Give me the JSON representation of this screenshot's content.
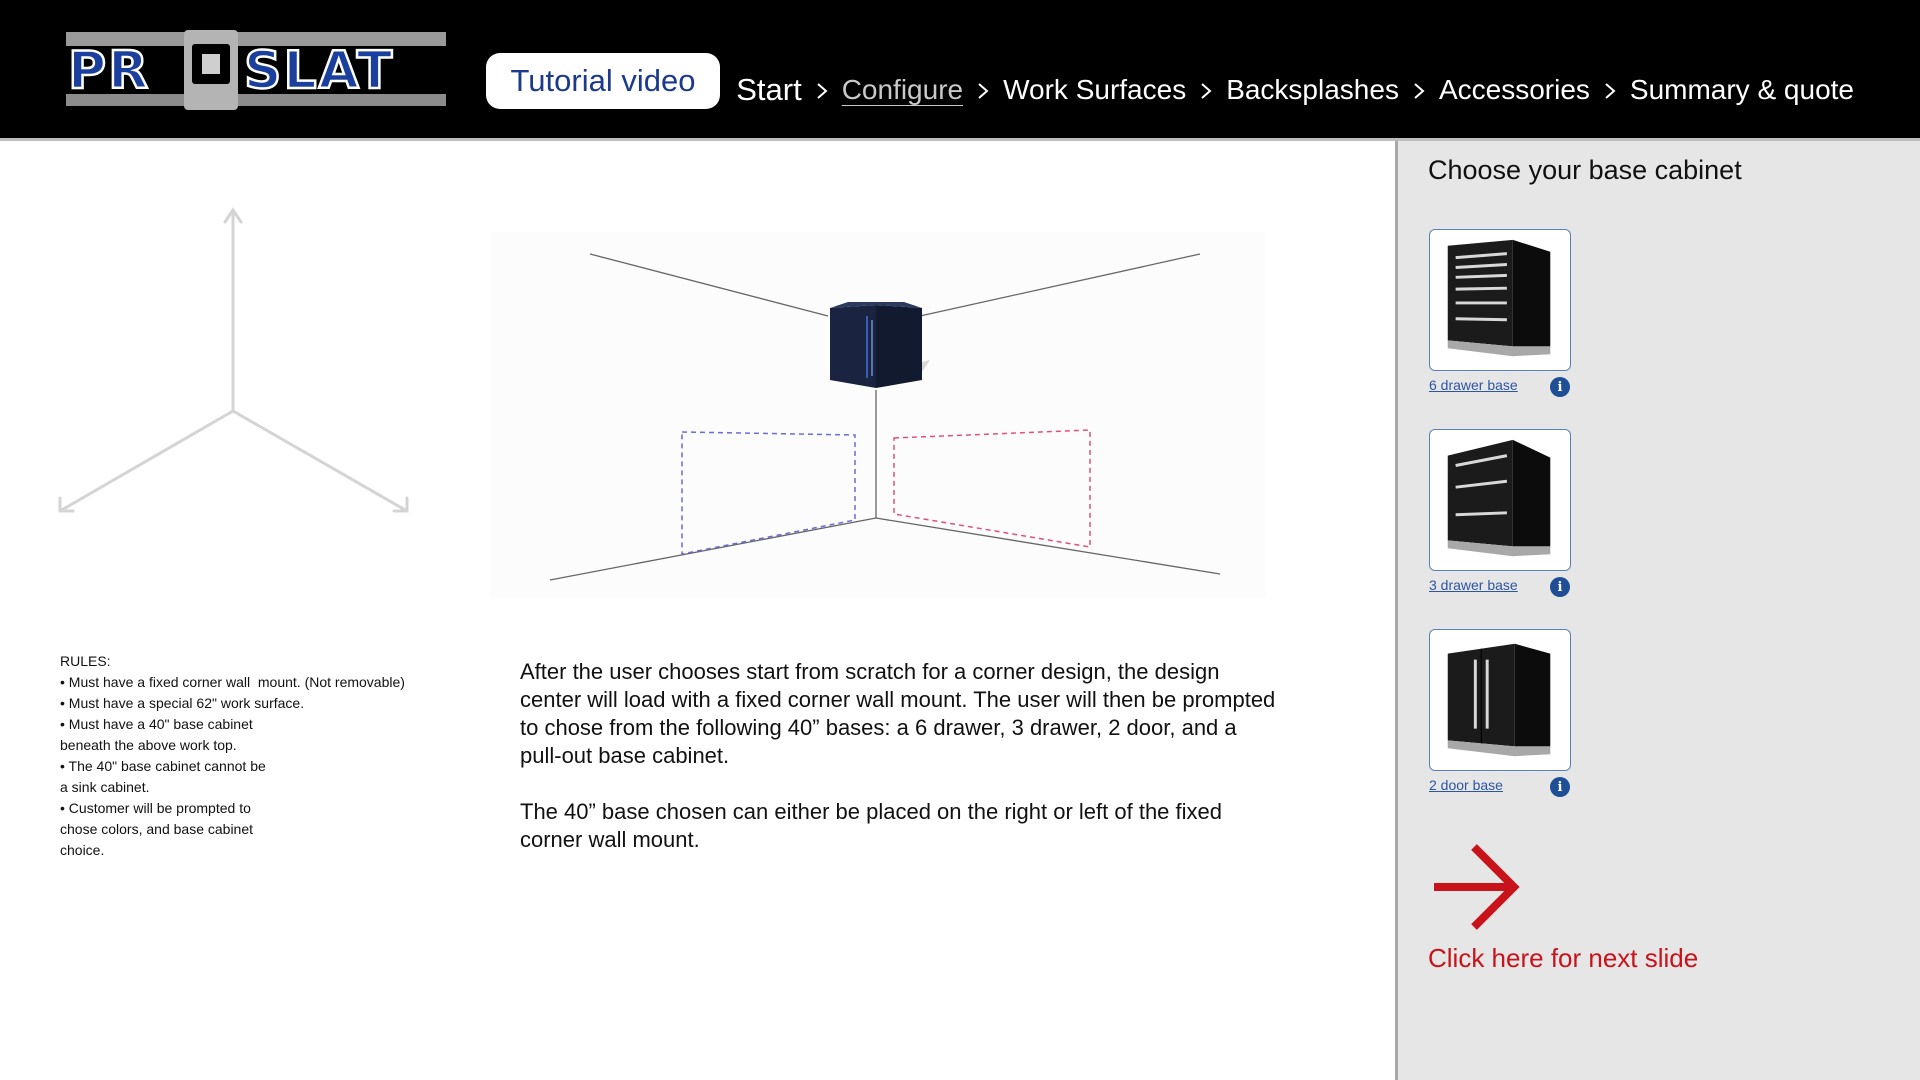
{
  "header": {
    "logo_alt": "PROSLAT",
    "tutorial_button": "Tutorial video",
    "breadcrumb": [
      {
        "label": "Start",
        "active": false
      },
      {
        "label": "Configure",
        "active": true
      },
      {
        "label": "Work Surfaces",
        "active": false
      },
      {
        "label": "Backsplashes",
        "active": false
      },
      {
        "label": "Accessories",
        "active": false
      },
      {
        "label": "Summary & quote",
        "active": false
      }
    ]
  },
  "panel": {
    "title": "Choose your base cabinet",
    "cabinets": [
      {
        "label": "6 drawer base",
        "info_icon": "i"
      },
      {
        "label": "3 drawer base",
        "info_icon": "i"
      },
      {
        "label": "2 door base",
        "info_icon": "i"
      }
    ],
    "next_label": "Click here for next slide",
    "next_icon": "arrow-right-icon",
    "accent_color": "#c8131b"
  },
  "rules": {
    "heading": "RULES:",
    "lines": [
      "• Must have a fixed corner wall  mount. (Not removable)",
      "• Must have a special 62\" work surface.",
      "• Must have a 40\" base cabinet",
      "beneath the above work top.",
      "• The 40\" base cabinet cannot be",
      "a sink cabinet.",
      "• Customer will be prompted to",
      "chose colors, and base cabinet",
      "choice."
    ]
  },
  "description": {
    "paragraph1": "After the user chooses start from scratch for a corner design, the design center will load with a fixed corner wall mount. The user will then be prompted to chose from the following 40” bases: a 6 drawer, 3 drawer, 2 door, and a pull-out base cabinet.",
    "paragraph2": "The 40” base chosen can either be placed on the right or left of the fixed corner wall mount."
  },
  "colors": {
    "header_bg": "#000000",
    "brand_blue": "#1c3a8c",
    "link_blue": "#2d55a3",
    "left_zone": "#6b6bd6",
    "right_zone": "#e0507a"
  }
}
